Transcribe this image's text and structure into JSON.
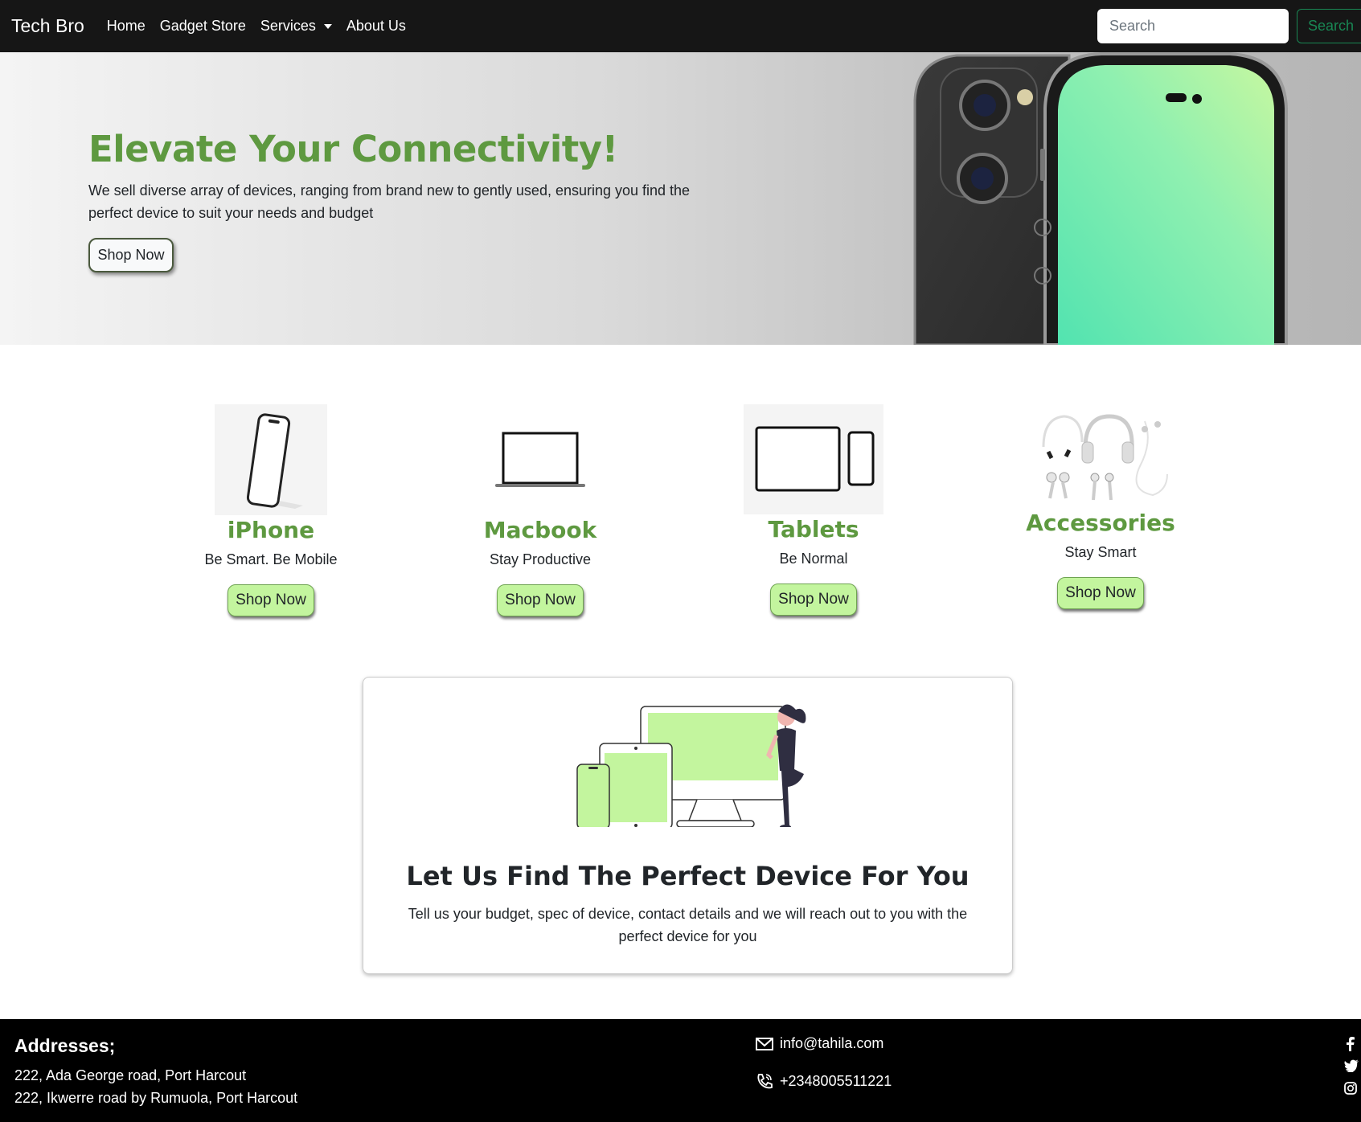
{
  "navbar": {
    "brand": "Tech Bro",
    "links": [
      "Home",
      "Gadget Store",
      "Services",
      "About Us"
    ],
    "search_placeholder": "Search",
    "search_button": "Search"
  },
  "hero": {
    "title": "Elevate Your Connectivity!",
    "text": "We sell diverse array of devices, ranging from brand new to gently used, ensuring you find the perfect device to suit your needs and budget",
    "button": "Shop Now"
  },
  "categories": [
    {
      "title": "iPhone",
      "subtitle": "Be Smart. Be Mobile",
      "button": "Shop Now"
    },
    {
      "title": "Macbook",
      "subtitle": "Stay Productive",
      "button": "Shop Now"
    },
    {
      "title": "Tablets",
      "subtitle": "Be Normal",
      "button": "Shop Now"
    },
    {
      "title": "Accessories",
      "subtitle": "Stay Smart",
      "button": "Shop Now"
    }
  ],
  "finder": {
    "title": "Let Us Find The Perfect Device For You",
    "text": "Tell us your budget, spec of device, contact details and we will reach out to you with the perfect device for you"
  },
  "footer": {
    "addresses_title": "Addresses;",
    "addresses": [
      "222, Ada George road, Port Harcout",
      "222, Ikwerre road by Rumuola, Port Harcout"
    ],
    "email": "info@tahila.com",
    "phone": "+2348005511221",
    "social_icons": [
      "facebook-icon",
      "twitter-icon",
      "instagram-icon"
    ]
  },
  "colors": {
    "accent_green": "#5e9940",
    "button_green": "#c3f59e",
    "navbar_bg": "#161616",
    "search_button_green": "#198754"
  }
}
